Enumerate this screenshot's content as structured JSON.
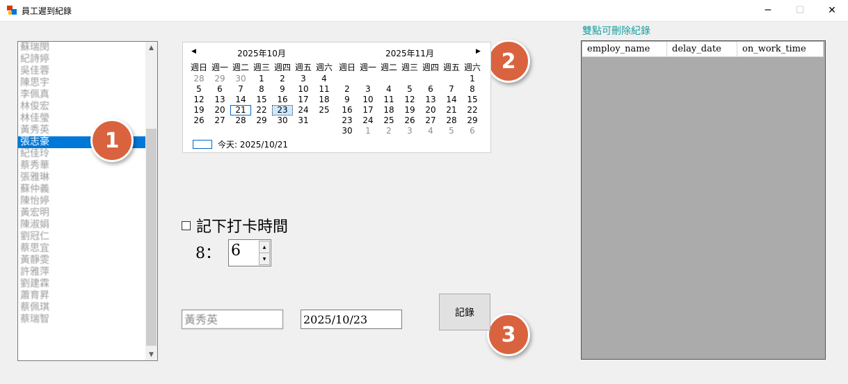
{
  "window": {
    "title": "員工遲到紀錄",
    "minimize_glyph": "─",
    "maximize_glyph": "☐",
    "close_glyph": "✕"
  },
  "employee_list": {
    "items": [
      "蘇瑞閔",
      "紀詩婷",
      "吳佳蓉",
      "陳思宇",
      "李佩真",
      "林俊宏",
      "林佳瑩",
      "黃秀英",
      "張志豪",
      "紀佳玲",
      "蔡秀華",
      "張雅琳",
      "蘇仲義",
      "陳怡婷",
      "黃宏明",
      "陳淑娟",
      "劉冠仁",
      "蔡思宜",
      "黃靜雯",
      "許雅萍",
      "劉建霖",
      "蕭育昇",
      "蔡佩琪",
      "蔡瑞智"
    ],
    "selected_index": 8,
    "scroll_up": "▲",
    "scroll_down": "▼"
  },
  "badges": [
    "1",
    "2",
    "3"
  ],
  "calendar": {
    "prev_glyph": "◀",
    "next_glyph": "▶",
    "weekdays": [
      "週日",
      "週一",
      "週二",
      "週三",
      "週四",
      "週五",
      "週六"
    ],
    "months": [
      {
        "title": "2025年10月",
        "days": [
          {
            "d": "28",
            "gray": true
          },
          {
            "d": "29",
            "gray": true
          },
          {
            "d": "30",
            "gray": true
          },
          {
            "d": "1"
          },
          {
            "d": "2"
          },
          {
            "d": "3"
          },
          {
            "d": "4"
          },
          {
            "d": "5"
          },
          {
            "d": "6"
          },
          {
            "d": "7"
          },
          {
            "d": "8"
          },
          {
            "d": "9"
          },
          {
            "d": "10"
          },
          {
            "d": "11"
          },
          {
            "d": "12"
          },
          {
            "d": "13"
          },
          {
            "d": "14"
          },
          {
            "d": "15"
          },
          {
            "d": "16"
          },
          {
            "d": "17"
          },
          {
            "d": "18"
          },
          {
            "d": "19"
          },
          {
            "d": "20"
          },
          {
            "d": "21",
            "today": true
          },
          {
            "d": "22"
          },
          {
            "d": "23",
            "selected": true
          },
          {
            "d": "24"
          },
          {
            "d": "25"
          },
          {
            "d": "26"
          },
          {
            "d": "27"
          },
          {
            "d": "28"
          },
          {
            "d": "29"
          },
          {
            "d": "30"
          },
          {
            "d": "31"
          },
          {
            "d": ""
          }
        ]
      },
      {
        "title": "2025年11月",
        "days": [
          {
            "d": ""
          },
          {
            "d": ""
          },
          {
            "d": ""
          },
          {
            "d": ""
          },
          {
            "d": ""
          },
          {
            "d": ""
          },
          {
            "d": "1"
          },
          {
            "d": "2"
          },
          {
            "d": "3"
          },
          {
            "d": "4"
          },
          {
            "d": "5"
          },
          {
            "d": "6"
          },
          {
            "d": "7"
          },
          {
            "d": "8"
          },
          {
            "d": "9"
          },
          {
            "d": "10"
          },
          {
            "d": "11"
          },
          {
            "d": "12"
          },
          {
            "d": "13"
          },
          {
            "d": "14"
          },
          {
            "d": "15"
          },
          {
            "d": "16"
          },
          {
            "d": "17"
          },
          {
            "d": "18"
          },
          {
            "d": "19"
          },
          {
            "d": "20"
          },
          {
            "d": "21"
          },
          {
            "d": "22"
          },
          {
            "d": "23"
          },
          {
            "d": "24"
          },
          {
            "d": "25"
          },
          {
            "d": "26"
          },
          {
            "d": "27"
          },
          {
            "d": "28"
          },
          {
            "d": "29"
          },
          {
            "d": "30"
          },
          {
            "d": "1",
            "gray": true
          },
          {
            "d": "2",
            "gray": true
          },
          {
            "d": "3",
            "gray": true
          },
          {
            "d": "4",
            "gray": true
          },
          {
            "d": "5",
            "gray": true
          },
          {
            "d": "6",
            "gray": true
          }
        ]
      }
    ],
    "today_label": "今天: 2025/10/21"
  },
  "punch": {
    "checkbox_label": "記下打卡時間",
    "hour_label": "8：",
    "minute_value": "6",
    "spin_up": "▲",
    "spin_down": "▼"
  },
  "form": {
    "name_value": "黃秀英",
    "date_value": "2025/10/23",
    "record_button": "記錄"
  },
  "grid": {
    "caption": "雙點可刪除紀錄",
    "columns": [
      "employ_name",
      "delay_date",
      "on_work_time"
    ]
  }
}
